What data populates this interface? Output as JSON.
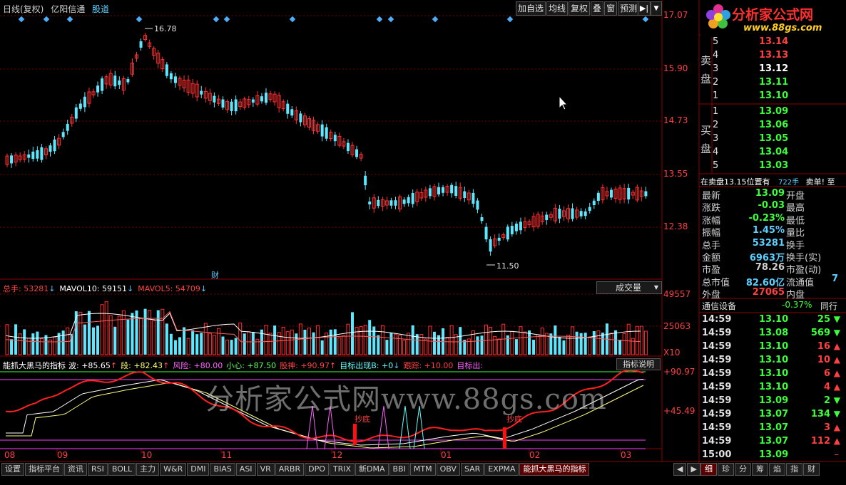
{
  "topbar": {
    "period": "日线(复权)",
    "stock_name": "亿阳信通",
    "stock_dao": "股道",
    "buttons": [
      "加自选",
      "均线",
      "复权",
      "叠",
      "窗",
      "预测"
    ]
  },
  "watermark": "分析家公式网www.88gs.com",
  "logo": {
    "title": "分析家公式网",
    "url": "www.88gs.com"
  },
  "price_axis": [
    "17.07",
    "15.90",
    "14.73",
    "13.55",
    "12.38"
  ],
  "price_annot": {
    "high": "16.78",
    "low": "11.50",
    "cai": "财"
  },
  "volume": {
    "header": [
      {
        "label": "总手: 53281",
        "color": "#ff4040",
        "arrow": "↓",
        "arrow_color": "#60c0ff"
      },
      {
        "label": "MAVOL10: 59151",
        "color": "#ffffff",
        "arrow": "↓",
        "arrow_color": "#60c0ff"
      },
      {
        "label": "MAVOL5: 54709",
        "color": "#ff4040",
        "arrow": "↓",
        "arrow_color": "#60c0ff"
      }
    ],
    "dropdown": "成交量",
    "axis": [
      "49557",
      "25063",
      "X10"
    ]
  },
  "indicator": {
    "name": "能抓大黑马的指标",
    "items": [
      {
        "label": "波: +85.65",
        "color": "#ffffff",
        "arrow": "↑",
        "arrow_color": "#ff5050"
      },
      {
        "label": "段: +82.43",
        "color": "#ffff60",
        "arrow": "↑",
        "arrow_color": "#ff5050"
      },
      {
        "label": "风险: +80.00",
        "color": "#ff60ff",
        "arrow": "",
        "arrow_color": ""
      },
      {
        "label": "小心: +87.50",
        "color": "#60ff60",
        "arrow": "",
        "arrow_color": ""
      },
      {
        "label": "股神: +90.97",
        "color": "#ff4040",
        "arrow": "↑",
        "arrow_color": "#ff5050"
      },
      {
        "label": "目标出现B: +0",
        "color": "#60ffff",
        "arrow": "↓",
        "arrow_color": "#60c0ff"
      },
      {
        "label": "跟踪: +10.00",
        "color": "#ff4040",
        "arrow": "",
        "arrow_color": ""
      },
      {
        "label": "目标出:",
        "color": "#ff60ff",
        "arrow": "",
        "arrow_color": ""
      }
    ],
    "button": "指标说明",
    "axis": [
      "+90.97",
      "+45.49"
    ],
    "chaodi": "抄底"
  },
  "date_axis": [
    "08",
    "09",
    "10",
    "11",
    "12",
    "01",
    "02",
    "03"
  ],
  "bottom_tabs": [
    "设置",
    "指标平台",
    "资讯",
    "RSI",
    "BOLL",
    "主力",
    "W&R",
    "DMI",
    "BIAS",
    "ASI",
    "VR",
    "ARBR",
    "DPO",
    "TRIX",
    "新DMA",
    "BBI",
    "MTM",
    "OBV",
    "SAR",
    "EXPMA",
    "能抓大黑马的指标"
  ],
  "right_tabs": [
    "细",
    "珍",
    "分",
    "筹",
    "焰",
    "指",
    "财"
  ],
  "orderbook": {
    "sell_label": [
      "卖",
      "盘"
    ],
    "buy_label": [
      "买",
      "盘"
    ],
    "sell": [
      {
        "lvl": "5",
        "price": "13.14",
        "color": "#ff4040"
      },
      {
        "lvl": "4",
        "price": "13.13",
        "color": "#ff4040"
      },
      {
        "lvl": "3",
        "price": "13.12",
        "color": "#ffffff"
      },
      {
        "lvl": "2",
        "price": "13.11",
        "color": "#3cff3c"
      },
      {
        "lvl": "1",
        "price": "13.10",
        "color": "#3cff3c"
      }
    ],
    "buy": [
      {
        "lvl": "1",
        "price": "13.09",
        "color": "#3cff3c"
      },
      {
        "lvl": "2",
        "price": "13.06",
        "color": "#3cff3c"
      },
      {
        "lvl": "3",
        "price": "13.05",
        "color": "#3cff3c"
      },
      {
        "lvl": "4",
        "price": "13.04",
        "color": "#3cff3c"
      },
      {
        "lvl": "5",
        "price": "13.03",
        "color": "#3cff3c"
      }
    ]
  },
  "sell_note": {
    "text": "在卖盘13.15位置有",
    "qty": "722手",
    "tail": "卖单!",
    "extra": "至"
  },
  "stats": [
    {
      "k": "最新",
      "v": "13.09",
      "vc": "#3cff3c",
      "k2": "开盘"
    },
    {
      "k": "涨跌",
      "v": "-0.03",
      "vc": "#3cff3c",
      "k2": "最高"
    },
    {
      "k": "涨幅",
      "v": "-0.23%",
      "vc": "#3cff3c",
      "k2": "最低"
    },
    {
      "k": "振幅",
      "v": "1.45%",
      "vc": "#5bd0ff",
      "k2": "量比"
    },
    {
      "k": "总手",
      "v": "53281",
      "vc": "#5bd0ff",
      "k2": "换手"
    },
    {
      "k": "金额",
      "v": "6963万",
      "vc": "#5bd0ff",
      "k2": "换手(实)"
    },
    {
      "k": "市盈",
      "v": "78.26",
      "vc": "#d0d0d0",
      "k2": "市盈(动)"
    },
    {
      "k": "总市值",
      "v": "82.60亿",
      "vc": "#5bd0ff",
      "k2": "流通值"
    },
    {
      "k": "外盘",
      "v": "27065",
      "vc": "#ff4040",
      "k2": "内盘"
    }
  ],
  "stats_extra": "7",
  "sector": {
    "name": "通信设备",
    "change": "-0.37%",
    "right": "同行"
  },
  "ticks": [
    {
      "t": "14:59",
      "p": "13.10",
      "v": "25",
      "dir": "down"
    },
    {
      "t": "14:59",
      "p": "13.08",
      "v": "569",
      "dir": "down"
    },
    {
      "t": "14:59",
      "p": "13.10",
      "v": "16",
      "dir": "up"
    },
    {
      "t": "14:59",
      "p": "13.10",
      "v": "10",
      "dir": "up"
    },
    {
      "t": "14:59",
      "p": "13.10",
      "v": "6",
      "dir": "up"
    },
    {
      "t": "14:59",
      "p": "13.10",
      "v": "4",
      "dir": "up"
    },
    {
      "t": "14:59",
      "p": "13.09",
      "v": "2",
      "dir": "down"
    },
    {
      "t": "14:59",
      "p": "13.07",
      "v": "134",
      "dir": "down"
    },
    {
      "t": "14:59",
      "p": "13.07",
      "v": "3",
      "dir": "up"
    },
    {
      "t": "14:59",
      "p": "13.07",
      "v": "112",
      "dir": "up"
    },
    {
      "t": "15:00",
      "p": "13.09",
      "v": "",
      "dir": "none"
    }
  ]
}
